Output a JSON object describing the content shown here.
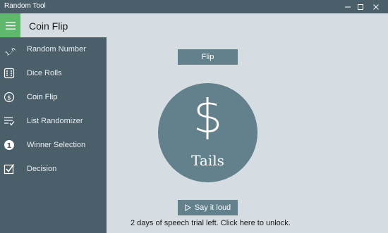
{
  "window": {
    "title": "Random Tool",
    "controls": {
      "minimize_icon": "minimize-icon",
      "maximize_icon": "maximize-icon",
      "close_icon": "close-icon"
    }
  },
  "header": {
    "menu_icon": "hamburger-icon",
    "page_title": "Coin Flip",
    "accent_color": "#5fb86c"
  },
  "sidebar": {
    "items": [
      {
        "label": "Random Number",
        "icon": "random-number-icon"
      },
      {
        "label": "Dice Rolls",
        "icon": "dice-icon"
      },
      {
        "label": "Coin Flip",
        "icon": "coin-icon",
        "active": true
      },
      {
        "label": "List Randomizer",
        "icon": "list-randomizer-icon"
      },
      {
        "label": "Winner Selection",
        "icon": "winner-number-icon"
      },
      {
        "label": "Decision",
        "icon": "checkbox-icon"
      }
    ],
    "background_color": "#4b5f6b"
  },
  "main": {
    "flip_label": "Flip",
    "coin_symbol": "$",
    "coin_result": "Tails",
    "say_label": "Say it loud",
    "trial_prefix": "2 days of speech trial left. Click ",
    "trial_link": "here",
    "trial_suffix": " to unlock.",
    "button_color": "#63808d",
    "background_color": "#d6dde2"
  }
}
